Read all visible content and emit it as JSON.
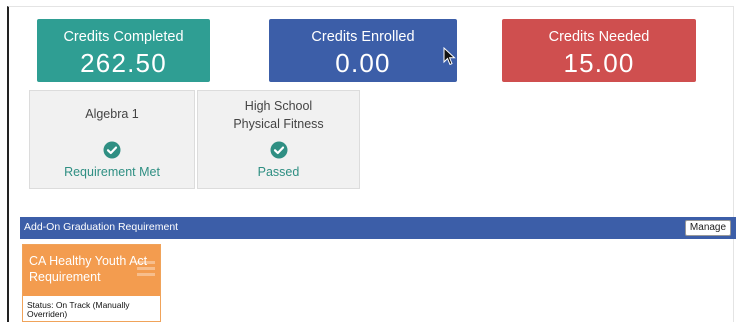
{
  "credits": {
    "completed": {
      "label": "Credits Completed",
      "value": "262.50",
      "color": "#2f9e93"
    },
    "enrolled": {
      "label": "Credits Enrolled",
      "value": "0.00",
      "color": "#3c5ea8"
    },
    "needed": {
      "label": "Credits Needed",
      "value": "15.00",
      "color": "#cf4f4f"
    }
  },
  "requirements": [
    {
      "name": "Algebra 1",
      "status": "Requirement Met",
      "icon": "check-circle-icon"
    },
    {
      "name_line1": "High School",
      "name_line2": "Physical Fitness",
      "status": "Passed",
      "icon": "check-circle-icon"
    }
  ],
  "addon_section": {
    "title": "Add-On Graduation Requirement",
    "manage_label": "Manage",
    "color": "#3c5ea8"
  },
  "addon_cards": [
    {
      "title": "CA Healthy Youth Act Requirement",
      "status": "Status: On Track (Manually Overriden)",
      "color": "#f39c4f"
    }
  ]
}
